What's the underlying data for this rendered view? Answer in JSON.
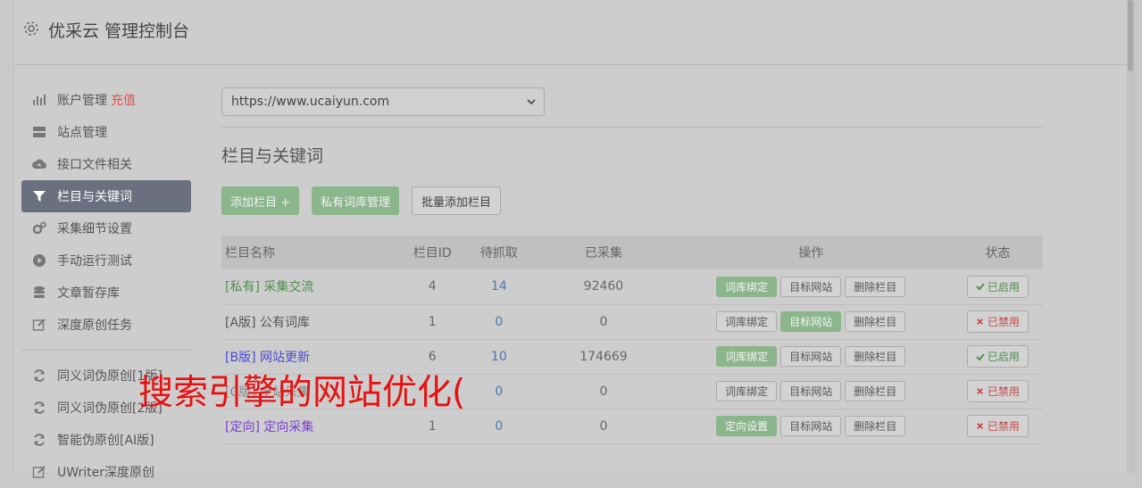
{
  "app": {
    "title": "优采云 管理控制台"
  },
  "sidebar": {
    "items": [
      {
        "label": "账户管理",
        "badge": "充值",
        "icon": "bar-chart-icon"
      },
      {
        "label": "站点管理",
        "icon": "server-icon"
      },
      {
        "label": "接口文件相关",
        "icon": "cloud-upload-icon"
      },
      {
        "label": "栏目与关键词",
        "icon": "filter-icon",
        "active": true
      },
      {
        "label": "采集细节设置",
        "icon": "cogs-icon"
      },
      {
        "label": "手动运行测试",
        "icon": "play-circle-icon"
      },
      {
        "label": "文章暂存库",
        "icon": "database-icon"
      },
      {
        "label": "深度原创任务",
        "icon": "edit-icon"
      },
      {
        "label": "同义词伪原创[1版]",
        "icon": "refresh-icon"
      },
      {
        "label": "同义词伪原创[2版]",
        "icon": "refresh-icon"
      },
      {
        "label": "智能伪原创[AI版]",
        "icon": "refresh-icon"
      },
      {
        "label": "UWriter深度原创",
        "icon": "edit-icon"
      }
    ]
  },
  "main": {
    "site_select": "https://www.ucaiyun.com",
    "section_title": "栏目与关键词",
    "buttons": {
      "add": "添加栏目 +",
      "private_lib": "私有词库管理",
      "batch_add": "批量添加栏目"
    },
    "table": {
      "headers": [
        "栏目名称",
        "栏目ID",
        "待抓取",
        "已采集",
        "操作",
        "状态"
      ],
      "rows": [
        {
          "name": "[私有] 采集交流",
          "id": "4",
          "pending": "14",
          "collected": "92460",
          "op1": "词库绑定",
          "op2": "目标网站",
          "op3": "删除栏目",
          "status": "已启用",
          "name_color": "#4f8f4f",
          "op1_green": true,
          "op2_green": false,
          "enabled": true
        },
        {
          "name": "[A版] 公有词库",
          "id": "1",
          "pending": "0",
          "collected": "0",
          "op1": "词库绑定",
          "op2": "目标网站",
          "op3": "删除栏目",
          "status": "已禁用",
          "name_color": "#555555",
          "op1_green": false,
          "op2_green": true,
          "enabled": false
        },
        {
          "name": "[B版] 网站更新",
          "id": "6",
          "pending": "10",
          "collected": "174669",
          "op1": "词库绑定",
          "op2": "目标网站",
          "op3": "删除栏目",
          "status": "已启用",
          "name_color": "#4a4ad0",
          "op1_green": true,
          "op2_green": false,
          "enabled": true
        },
        {
          "name": "[C版] 全站采集",
          "id": "",
          "pending": "0",
          "collected": "0",
          "op1": "词库绑定",
          "op2": "目标网站",
          "op3": "删除栏目",
          "status": "已禁用",
          "name_color": "#888888",
          "op1_green": false,
          "op2_green": false,
          "enabled": false
        },
        {
          "name": "[定向] 定向采集",
          "id": "1",
          "pending": "0",
          "collected": "0",
          "op1": "定向设置",
          "op2": "目标网站",
          "op3": "删除栏目",
          "status": "已禁用",
          "name_color": "#7a3fd0",
          "op1_green": true,
          "op2_green": false,
          "enabled": false
        }
      ]
    }
  },
  "overlay_text": "搜索引擎的网站优化("
}
